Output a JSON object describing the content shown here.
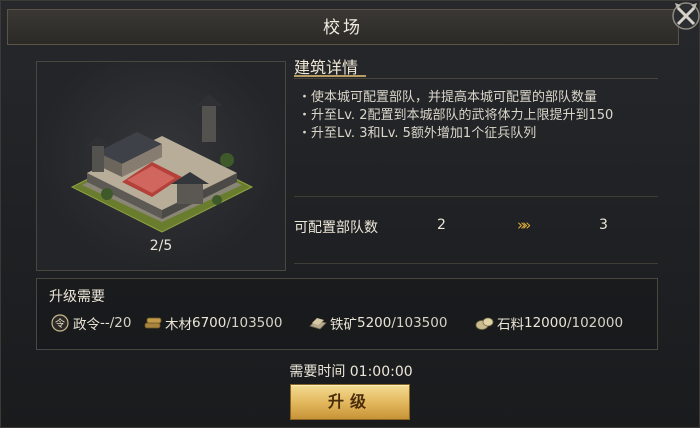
{
  "window": {
    "title": "校场"
  },
  "building": {
    "level": "2/5"
  },
  "details": {
    "heading": "建筑详情",
    "lines": [
      "・使本城可配置部队，并提高本城可配置的部队数量",
      "・升至Lv. 2配置到本城部队的武将体力上限提升到150",
      "・升至Lv. 3和Lv. 5额外增加1个征兵队列"
    ]
  },
  "stat": {
    "label": "可配置部队数",
    "current": "2",
    "arrow": "»»",
    "next": "3"
  },
  "requirements": {
    "heading": "升级需要",
    "items": [
      {
        "icon": "decree-icon",
        "label": "政令",
        "have": "--",
        "need": "/20"
      },
      {
        "icon": "wood-icon",
        "label": "木材",
        "have": "6700",
        "need": "/103500"
      },
      {
        "icon": "iron-ore-icon",
        "label": "铁矿",
        "have": "5200",
        "need": "/103500"
      },
      {
        "icon": "stone-icon",
        "label": "石料",
        "have": "12000",
        "need": "/102000"
      }
    ]
  },
  "time": {
    "text": "需要时间 01:00:00"
  },
  "upgrade": {
    "label": "升级"
  },
  "colors": {
    "accent_gold": "#e1b55a",
    "arrow_gold": "#d8a93c"
  }
}
